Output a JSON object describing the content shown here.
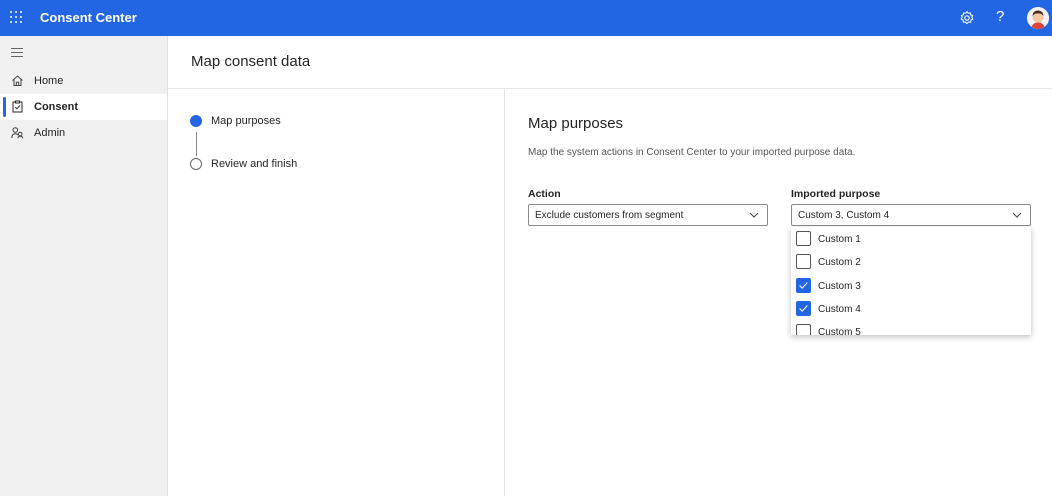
{
  "topbar": {
    "app_title": "Consent Center",
    "help_glyph": "?"
  },
  "colors": {
    "brand": "#2266e3",
    "accent": "#2266e3"
  },
  "sidebar": {
    "items": [
      {
        "label": "Home",
        "icon": "home-icon"
      },
      {
        "label": "Consent",
        "icon": "clipboard-check-icon",
        "active": true
      },
      {
        "label": "Admin",
        "icon": "people-icon"
      }
    ]
  },
  "page": {
    "title": "Map consent data"
  },
  "steps": [
    {
      "label": "Map purposes",
      "state": "current"
    },
    {
      "label": "Review and finish",
      "state": "pending"
    }
  ],
  "panel": {
    "title": "Map purposes",
    "description": "Map the system actions in Consent Center to your imported purpose data.",
    "action_label": "Action",
    "action_value": "Exclude customers from segment",
    "purpose_label": "Imported purpose",
    "purpose_value": "Custom 3, Custom 4"
  },
  "purpose_options": [
    {
      "label": "Custom 1",
      "checked": false
    },
    {
      "label": "Custom 2",
      "checked": false
    },
    {
      "label": "Custom 3",
      "checked": true
    },
    {
      "label": "Custom 4",
      "checked": true
    },
    {
      "label": "Custom 5",
      "checked": false
    }
  ]
}
